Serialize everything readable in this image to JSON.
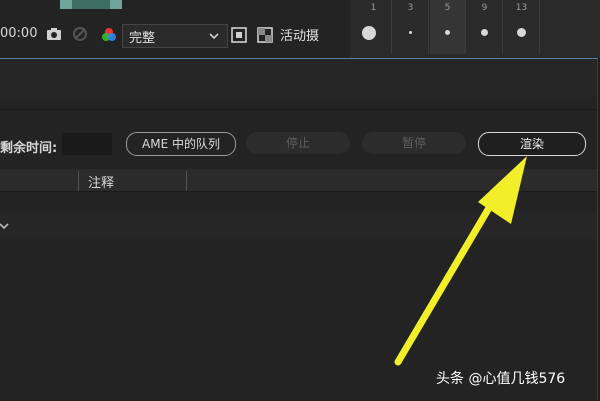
{
  "viewer": {
    "timecode": "00:00",
    "resolution": "完整",
    "active_camera": "活动摄"
  },
  "brushes": {
    "numbers": [
      "1",
      "3",
      "5",
      "9",
      "13"
    ]
  },
  "render_queue": {
    "remaining_label": "剩余时间:",
    "ame_button": "AME 中的队列",
    "stop_button": "停止",
    "pause_button": "暂停",
    "render_button": "渲染",
    "column_comment": "注释"
  },
  "watermark": "头条 @心值几钱576",
  "colors": {
    "arrow": "#f2ee2a",
    "panel_border": "#5a7fa6"
  }
}
